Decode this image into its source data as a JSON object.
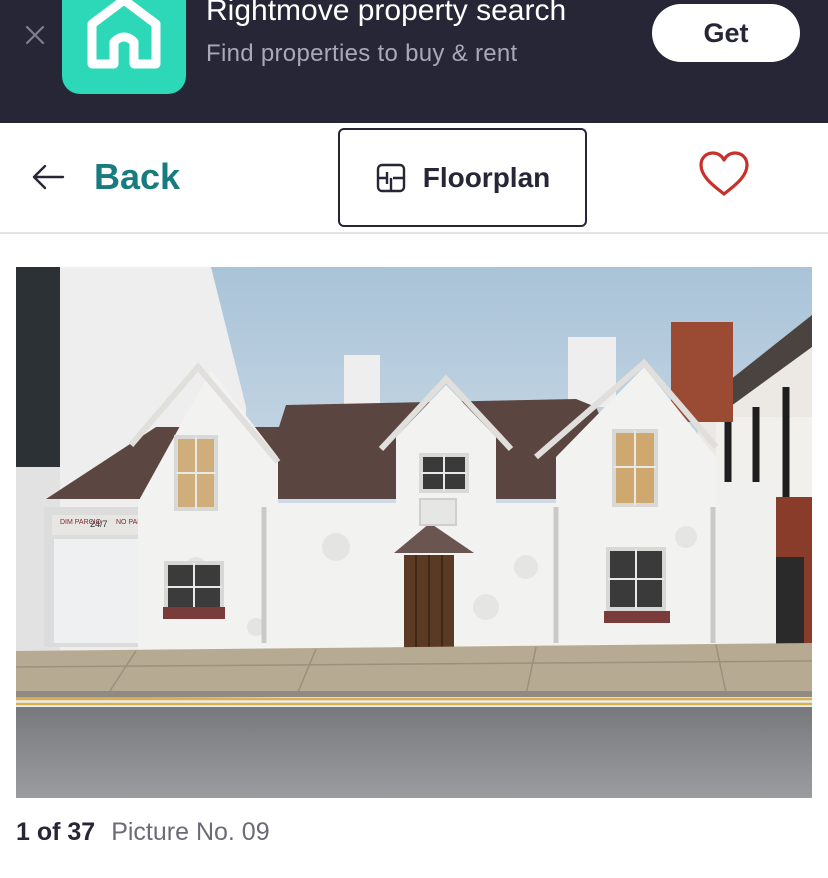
{
  "banner": {
    "title": "Rightmove property search",
    "subtitle": "Find properties to buy & rent",
    "get_label": "Get",
    "app_icon": "rightmove-house-logo",
    "close_icon": "close-icon"
  },
  "toolbar": {
    "back_label": "Back",
    "floorplan_label": "Floorplan",
    "icons": [
      "arrow-left-icon",
      "floorplan-icon",
      "heart-icon"
    ]
  },
  "gallery": {
    "counter": "1 of 37",
    "caption": "Picture No. 09",
    "sign_left": "DIM PARCIO",
    "sign_mid": "24/7",
    "sign_right": "NO PARKING"
  },
  "colors": {
    "banner_bg": "#262637",
    "app_icon_bg": "#2dd8b8",
    "accent_teal": "#177b80",
    "heart_red": "#c8302a",
    "text_dark": "#262637",
    "text_muted": "#6b6b78"
  }
}
